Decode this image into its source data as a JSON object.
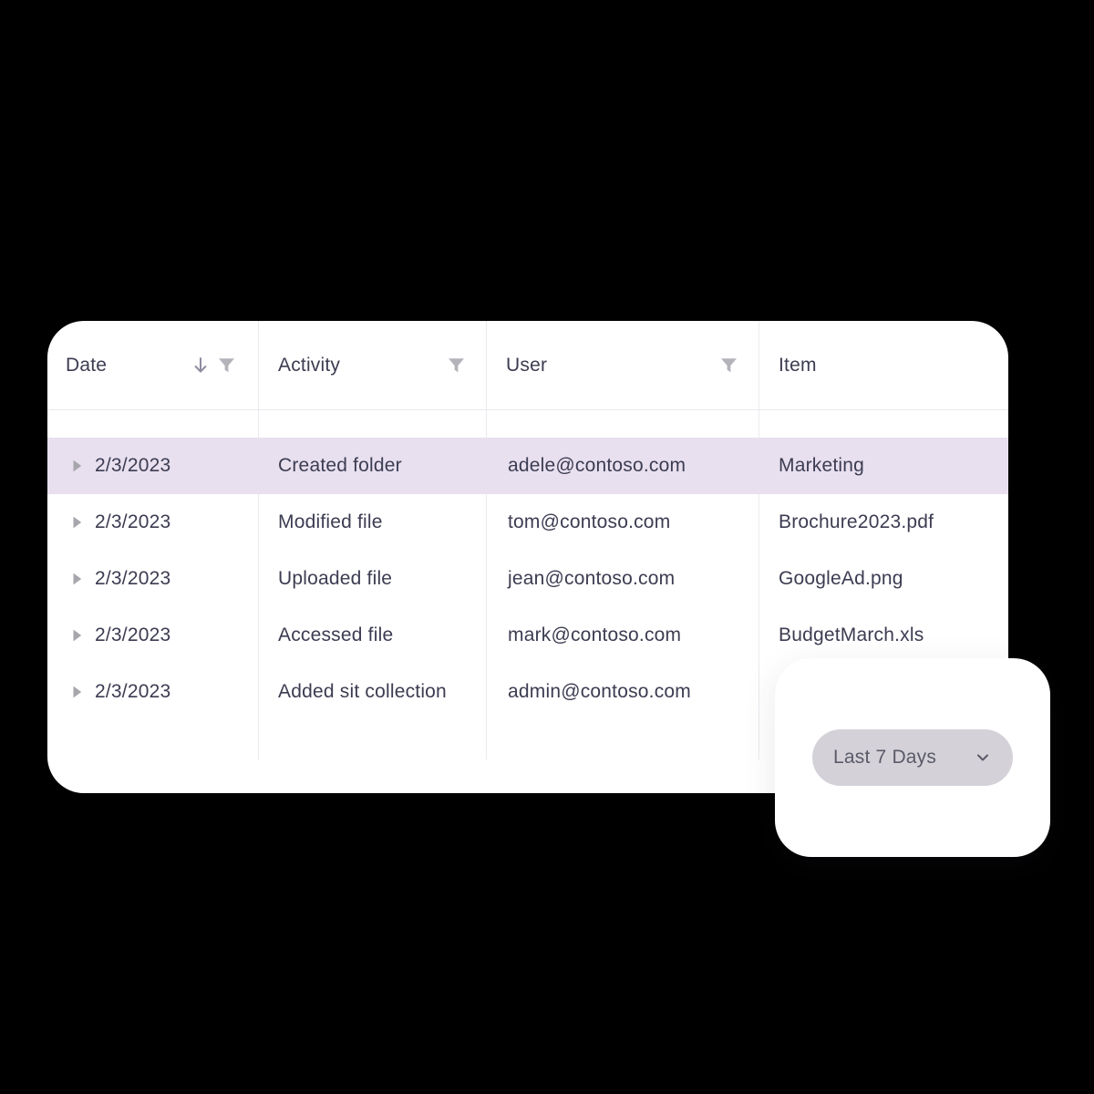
{
  "table": {
    "columns": [
      {
        "label": "Date",
        "sort_icon": "arrow-down-icon",
        "filter_icon": "filter-funnel-icon",
        "sortable": true,
        "filterable": true
      },
      {
        "label": "Activity",
        "sort_icon": null,
        "filter_icon": "filter-funnel-icon",
        "sortable": false,
        "filterable": true
      },
      {
        "label": "User",
        "sort_icon": null,
        "filter_icon": "filter-funnel-icon",
        "sortable": false,
        "filterable": true
      },
      {
        "label": "Item",
        "sort_icon": null,
        "filter_icon": null,
        "sortable": false,
        "filterable": false
      }
    ],
    "rows": [
      {
        "expander_icon": "triangle-right-icon",
        "date": "2/3/2023",
        "activity": "Created folder",
        "user": "adele@contoso.com",
        "item": "Marketing",
        "selected": true
      },
      {
        "expander_icon": "triangle-right-icon",
        "date": "2/3/2023",
        "activity": "Modified file",
        "user": "tom@contoso.com",
        "item": "Brochure2023.pdf",
        "selected": false
      },
      {
        "expander_icon": "triangle-right-icon",
        "date": "2/3/2023",
        "activity": "Uploaded file",
        "user": "jean@contoso.com",
        "item": "GoogleAd.png",
        "selected": false
      },
      {
        "expander_icon": "triangle-right-icon",
        "date": "2/3/2023",
        "activity": "Accessed file",
        "user": "mark@contoso.com",
        "item": "BudgetMarch.xls",
        "selected": false
      },
      {
        "expander_icon": "triangle-right-icon",
        "date": "2/3/2023",
        "activity": "Added sit collection",
        "user": "admin@contoso.com",
        "item": "",
        "selected": false
      }
    ]
  },
  "filter_card": {
    "date_range": {
      "label": "Last 7 Days",
      "chevron_icon": "chevron-down-icon"
    }
  },
  "colors": {
    "background": "#000000",
    "card": "#ffffff",
    "text": "#3c3c52",
    "selected_row": "#e8e0ef",
    "divider": "#ebe9ee",
    "icon_grey": "#b5b3ba",
    "sort_arrow": "#8e8ca0",
    "pill_background": "#d4d2d8",
    "pill_text": "#5b5a68"
  }
}
